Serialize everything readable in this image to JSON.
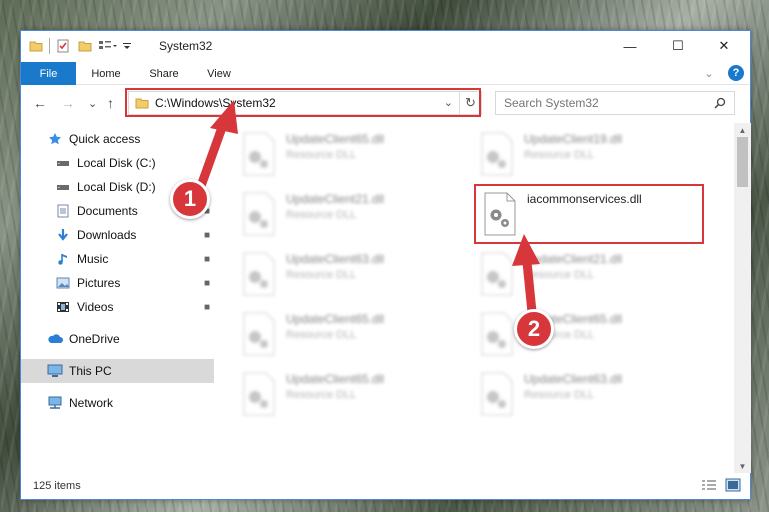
{
  "window": {
    "title": "System32",
    "minimize_glyph": "—",
    "maximize_glyph": "☐",
    "close_glyph": "✕"
  },
  "ribbon": {
    "tabs": [
      {
        "label": "File"
      },
      {
        "label": "Home"
      },
      {
        "label": "Share"
      },
      {
        "label": "View"
      }
    ],
    "help_glyph": "?",
    "expand_glyph": "⌄"
  },
  "nav": {
    "back_glyph": "←",
    "forward_glyph": "→",
    "recent_glyph": "⌄",
    "up_glyph": "↑",
    "address": "C:\\Windows\\System32",
    "refresh_glyph": "↻",
    "search_placeholder": "Search System32"
  },
  "sidebar": {
    "items": [
      {
        "label": "Quick access",
        "icon": "star-icon",
        "pinned": false
      },
      {
        "label": "Local Disk (C:)",
        "icon": "drive-icon",
        "pinned": false
      },
      {
        "label": "Local Disk (D:)",
        "icon": "drive-icon",
        "pinned": false
      },
      {
        "label": "Documents",
        "icon": "documents-icon",
        "pinned": true
      },
      {
        "label": "Downloads",
        "icon": "download-icon",
        "pinned": true
      },
      {
        "label": "Music",
        "icon": "music-icon",
        "pinned": true
      },
      {
        "label": "Pictures",
        "icon": "pictures-icon",
        "pinned": true
      },
      {
        "label": "Videos",
        "icon": "videos-icon",
        "pinned": true
      },
      {
        "label": "OneDrive",
        "icon": "cloud-icon",
        "pinned": false
      },
      {
        "label": "This PC",
        "icon": "computer-icon",
        "pinned": false,
        "selected": true
      },
      {
        "label": "Network",
        "icon": "network-icon",
        "pinned": false
      }
    ],
    "pin_glyph": "📌"
  },
  "files": {
    "left_column": [
      {
        "name": "UpdateClient65.dll",
        "type": "Resource DLL"
      },
      {
        "name": "UpdateClient21.dll",
        "type": "Resource DLL"
      },
      {
        "name": "UpdateClient63.dll",
        "type": "Resource DLL"
      },
      {
        "name": "UpdateClient65.dll",
        "type": "Resource DLL"
      },
      {
        "name": "UpdateClient65.dll",
        "type": "Resource DLL"
      }
    ],
    "right_column": [
      {
        "name": "UpdateClient19.dll",
        "type": "Resource DLL"
      },
      {
        "name": "iacommonservices.dll",
        "type": ""
      },
      {
        "name": "UpdateClient21.dll",
        "type": "Resource DLL"
      },
      {
        "name": "UpdateClient65.dll",
        "type": "Resource DLL"
      },
      {
        "name": "UpdateClient63.dll",
        "type": "Resource DLL"
      }
    ]
  },
  "status": {
    "item_count": "125 items"
  },
  "annotations": {
    "step1": "1",
    "step2": "2",
    "accent_color": "#d7373b"
  }
}
